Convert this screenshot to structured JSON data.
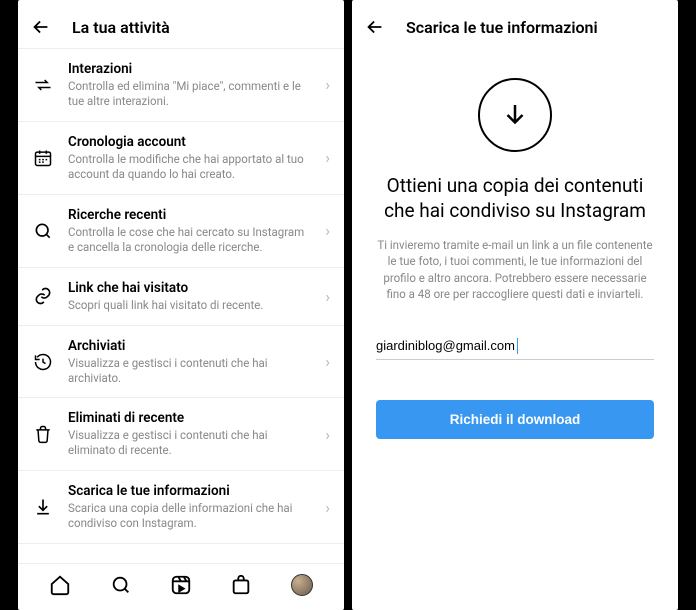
{
  "left": {
    "header_title": "La tua attività",
    "items": [
      {
        "title": "Interazioni",
        "sub": "Controlla ed elimina \"Mi piace\", commenti e le tue altre interazioni."
      },
      {
        "title": "Cronologia account",
        "sub": "Controlla le modifiche che hai apportato al tuo account da quando lo hai creato."
      },
      {
        "title": "Ricerche recenti",
        "sub": "Controlla le cose che hai cercato su Instagram e cancella la cronologia delle ricerche."
      },
      {
        "title": "Link che hai visitato",
        "sub": "Scopri quali link hai visitato di recente."
      },
      {
        "title": "Archiviati",
        "sub": "Visualizza e gestisci i contenuti che hai archiviato."
      },
      {
        "title": "Eliminati di recente",
        "sub": "Visualizza e gestisci i contenuti che hai eliminato di recente."
      },
      {
        "title": "Scarica le tue informazioni",
        "sub": "Scarica una copia delle informazioni che hai condiviso con Instagram."
      }
    ]
  },
  "right": {
    "header_title": "Scarica le tue informazioni",
    "big_title": "Ottieni una copia dei contenuti che hai condiviso su Instagram",
    "desc": "Ti invieremo tramite e-mail un link a un file contenente le tue foto, i tuoi commenti, le tue informazioni del profilo e altro ancora. Potrebbero essere necessarie fino a 48 ore per raccogliere questi dati e inviarteli.",
    "email": "giardiniblog@gmail.com",
    "cta": "Richiedi il download"
  }
}
